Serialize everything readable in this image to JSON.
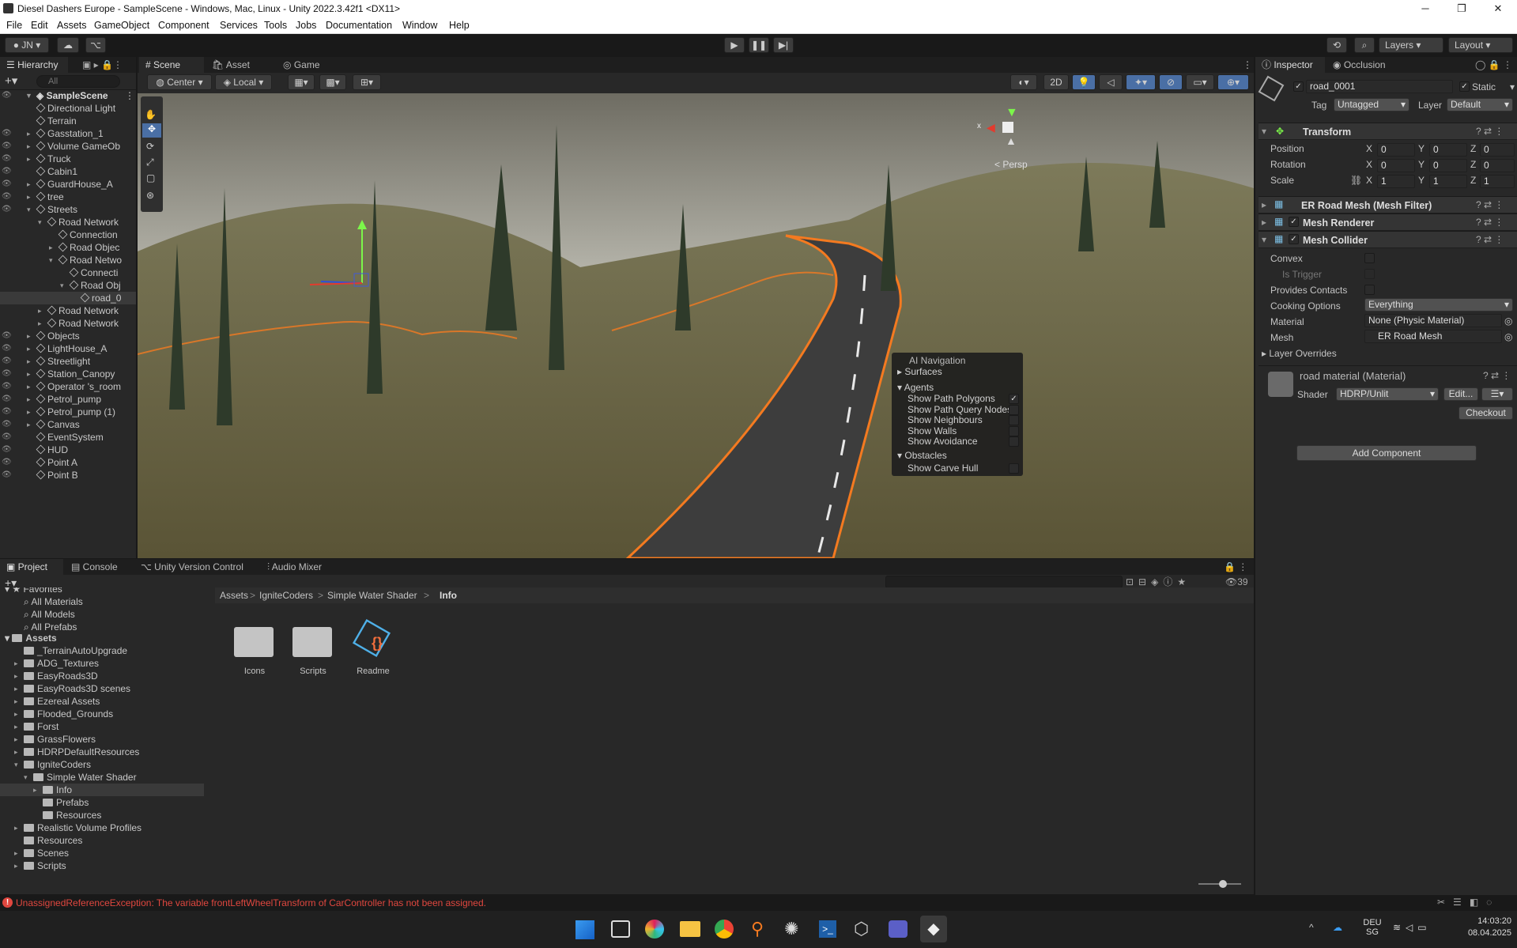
{
  "window": {
    "title": "Diesel Dashers Europe - SampleScene - Windows, Mac, Linux - Unity 2022.3.42f1 <DX11>",
    "min": "─",
    "max": "❐",
    "close": "✕"
  },
  "menu": [
    "File",
    "Edit",
    "Assets",
    "GameObject",
    "Component",
    "Services",
    "Tools",
    "Jobs",
    "Documentation",
    "Window",
    "Help"
  ],
  "toolbar": {
    "account": "JN",
    "layers": "Layers",
    "layout": "Layout"
  },
  "hierarchy": {
    "tab": "Hierarchy",
    "search_placeholder": "All",
    "scene": "SampleScene",
    "items": [
      "Directional Light",
      "Terrain",
      "Gasstation_1",
      "Volume GameOb",
      "Truck",
      "Cabin1",
      "GuardHouse_A",
      "tree",
      "Streets",
      "Road Network",
      "Connection",
      "Road Objec",
      "Road Netwo",
      "Connecti",
      "Road Obj",
      "road_0",
      "Road Network",
      "Road Network",
      "Objects",
      "LightHouse_A",
      "Streetlight",
      "Station_Canopy",
      "Operator 's_room",
      "Petrol_pump",
      "Petrol_pump (1)",
      "Canvas",
      "EventSystem",
      "HUD",
      "Point A",
      "Point B"
    ]
  },
  "scene_tabs": [
    "Scene",
    "Asset Store",
    "Game"
  ],
  "scene_toolbar": {
    "pivot": "Center",
    "space": "Local",
    "twod": "2D",
    "persp": "< Persp",
    "gizmo_x": "x"
  },
  "ai_nav": {
    "title": "AI Navigation",
    "surfaces": "Surfaces",
    "agents": "Agents",
    "items": [
      "Show Path Polygons",
      "Show Path Query Nodes",
      "Show Neighbours",
      "Show Walls",
      "Show Avoidance"
    ],
    "obstacles": "Obstacles",
    "carve": "Show Carve Hull",
    "checked": [
      true,
      false,
      false,
      false,
      false,
      false
    ]
  },
  "inspector": {
    "tabs": [
      "Inspector",
      "Occlusion"
    ],
    "name": "road_0001",
    "static": "Static",
    "tag_label": "Tag",
    "tag": "Untagged",
    "layer_label": "Layer",
    "layer": "Default",
    "transform": "Transform",
    "rows": [
      {
        "label": "Position",
        "x": "0",
        "y": "0",
        "z": "0"
      },
      {
        "label": "Rotation",
        "x": "0",
        "y": "0",
        "z": "0"
      },
      {
        "label": "Scale",
        "x": "1",
        "y": "1",
        "z": "1"
      }
    ],
    "comps": [
      "ER Road Mesh (Mesh Filter)",
      "Mesh Renderer",
      "Mesh Collider"
    ],
    "collider": {
      "convex": "Convex",
      "trigger": "Is Trigger",
      "contacts": "Provides Contacts",
      "cooking": "Cooking Options",
      "cooking_val": "Everything",
      "material": "Material",
      "material_val": "None (Physic Material)",
      "mesh": "Mesh",
      "mesh_val": "ER Road Mesh",
      "overrides": "Layer Overrides"
    },
    "material": {
      "name": "road material (Material)",
      "shader_label": "Shader",
      "shader": "HDRP/Unlit",
      "edit": "Edit...",
      "checkout": "Checkout"
    },
    "add_component": "Add Component"
  },
  "project": {
    "tabs": [
      "Project",
      "Console",
      "Unity Version Control",
      "Audio Mixer"
    ],
    "favorites": "Favorites",
    "fav_items": [
      "All Materials",
      "All Models",
      "All Prefabs"
    ],
    "assets": "Assets",
    "tree": [
      "_TerrainAutoUpgrade",
      "ADG_Textures",
      "EasyRoads3D",
      "EasyRoads3D scenes",
      "Ezereal Assets",
      "Flooded_Grounds",
      "Forst",
      "GrassFlowers",
      "HDRPDefaultResources",
      "IgniteCoders",
      "Simple Water Shader",
      "Info",
      "Prefabs",
      "Resources",
      "Realistic Volume Profiles",
      "Resources",
      "Scenes",
      "Scripts"
    ],
    "breadcrumb": [
      "Assets",
      "IgniteCoders",
      "Simple Water Shader",
      "Info"
    ],
    "files": [
      "Icons",
      "Scripts",
      "Readme"
    ],
    "count": "39"
  },
  "status": {
    "error": "UnassignedReferenceException: The variable frontLeftWheelTransform of CarController has not been assigned."
  },
  "taskbar": {
    "lang": "DEU",
    "region": "SG",
    "time": "14:03:20",
    "date": "08.04.2025"
  },
  "colors": {
    "accent": "#3a79bb",
    "error": "#e0473f",
    "selection": "#f47a20"
  }
}
